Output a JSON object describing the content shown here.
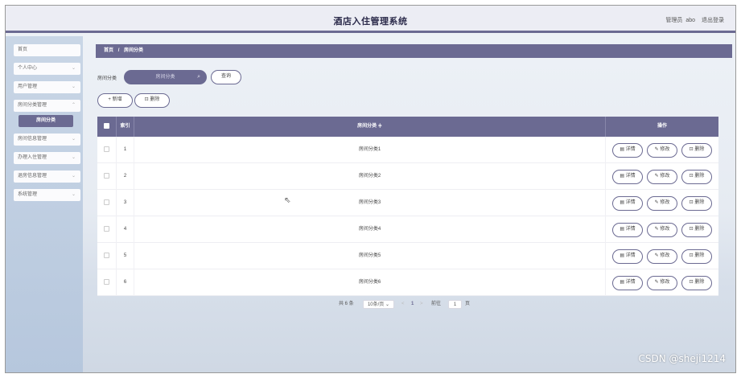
{
  "header": {
    "title": "酒店入住管理系统",
    "role": "管理员",
    "username": "abo",
    "logout_label": "退出登录"
  },
  "sidebar": {
    "items": [
      {
        "label": "首页",
        "has_children": false
      },
      {
        "label": "个人中心",
        "has_children": true
      },
      {
        "label": "用户管理",
        "has_children": true
      },
      {
        "label": "房间分类管理",
        "has_children": true
      },
      {
        "label": "房间分类",
        "active": true
      },
      {
        "label": "房间信息管理",
        "has_children": true
      },
      {
        "label": "办理入住管理",
        "has_children": true
      },
      {
        "label": "退房信息管理",
        "has_children": true
      },
      {
        "label": "系统管理",
        "has_children": true
      }
    ]
  },
  "breadcrumb": {
    "home": "首页",
    "separator": "/",
    "current": "房间分类"
  },
  "search": {
    "label": "房间分类",
    "placeholder": "房间分类",
    "button_label": "查询"
  },
  "actions": {
    "add_label": "+ 新增",
    "delete_label": "删除"
  },
  "table": {
    "columns": [
      "索引",
      "房间分类 ≑",
      "操作"
    ],
    "rows": [
      {
        "index": "1",
        "name": "房间分类1"
      },
      {
        "index": "2",
        "name": "房间分类2"
      },
      {
        "index": "3",
        "name": "房间分类3"
      },
      {
        "index": "4",
        "name": "房间分类4"
      },
      {
        "index": "5",
        "name": "房间分类5"
      },
      {
        "index": "6",
        "name": "房间分类6"
      }
    ],
    "row_actions": {
      "detail": "详情",
      "edit": "修改",
      "delete": "删除"
    }
  },
  "pagination": {
    "total_text": "共 6 条",
    "page_size": "10条/页",
    "current_page": "1",
    "prev": "<",
    "next": ">",
    "goto_label": "前往",
    "goto_value": "1",
    "page_suffix": "页"
  },
  "watermark": "CSDN @sheji1214",
  "colors": {
    "accent": "#6b6a92",
    "header_bg": "#ecedf4",
    "sidebar_bg": "#c2d0e3"
  }
}
